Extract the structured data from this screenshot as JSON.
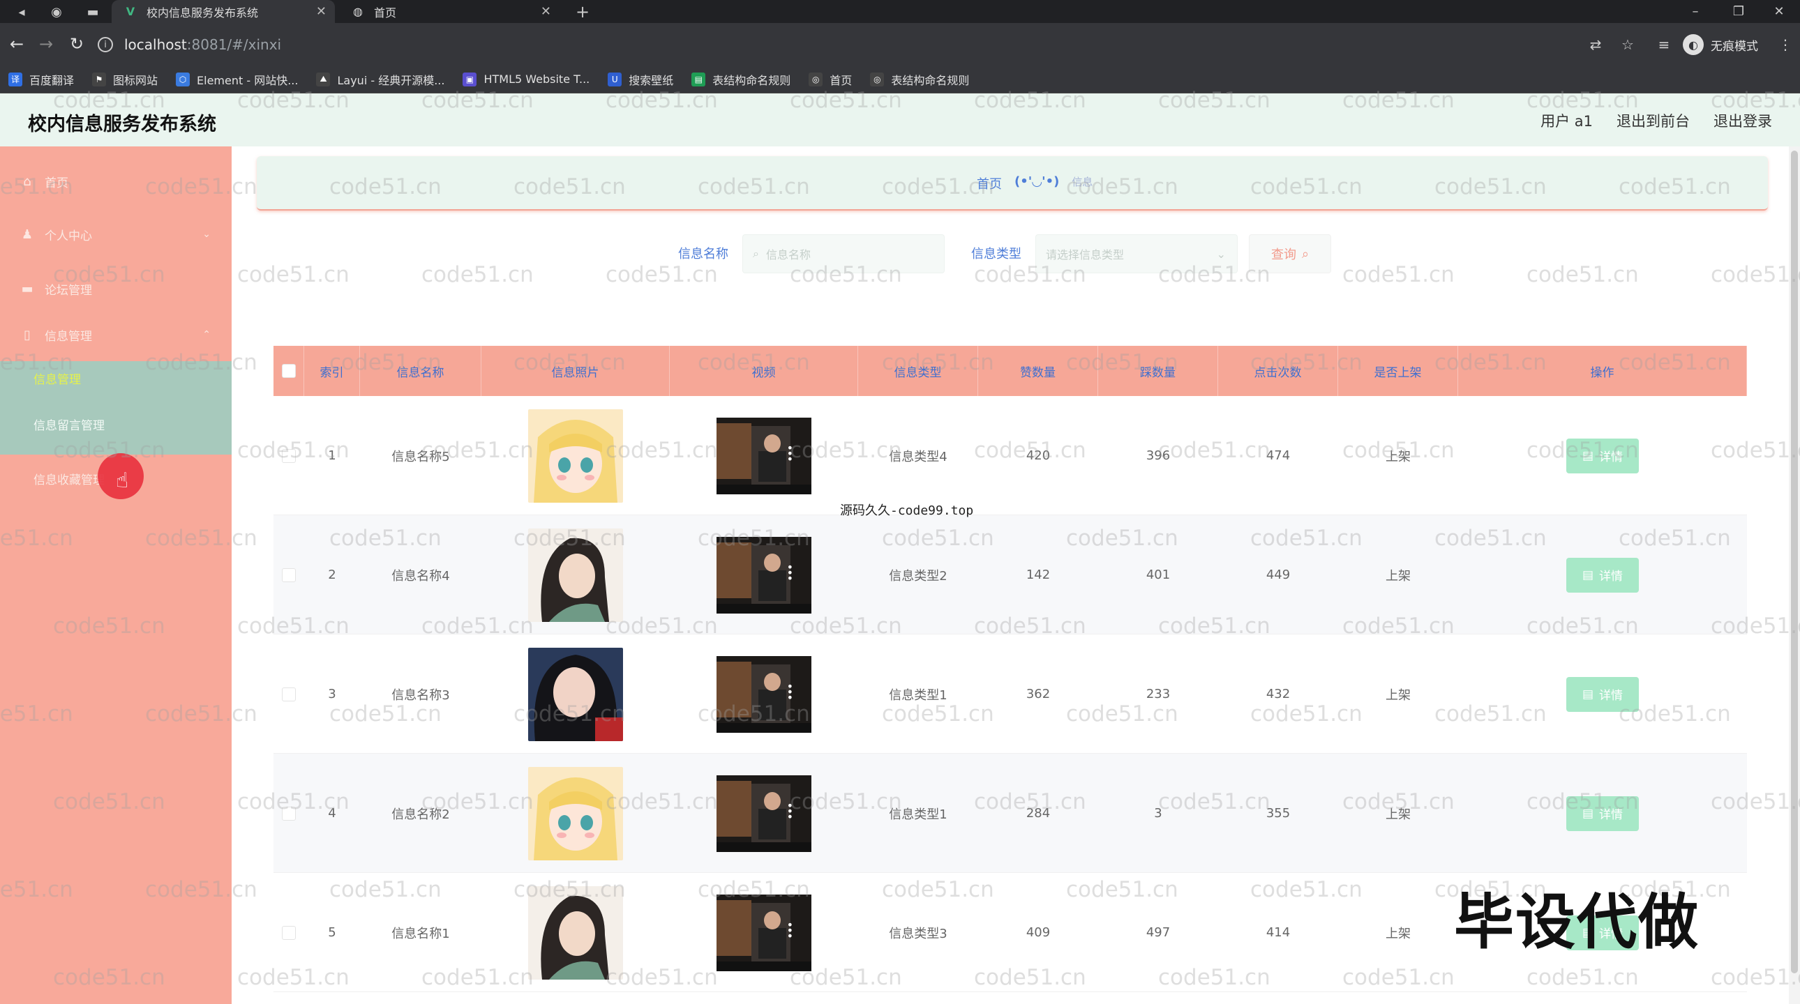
{
  "browser": {
    "tabs": [
      {
        "title": "校内信息服务发布系统",
        "favicon": "V",
        "active": true
      },
      {
        "title": "首页",
        "favicon": "globe",
        "active": false
      }
    ],
    "url_host": "localhost",
    "url_path": ":8081/#/xinxi",
    "incognito_label": "无痕模式",
    "bookmarks": [
      {
        "label": "百度翻译",
        "icon_color": "#2f6fe4",
        "icon": "译"
      },
      {
        "label": "图标网站",
        "icon_color": "#444444",
        "icon": "⚑"
      },
      {
        "label": "Element - 网站快...",
        "icon_color": "#3a7be0",
        "icon": "⬡"
      },
      {
        "label": "Layui - 经典开源模...",
        "icon_color": "#444444",
        "icon": "⛰"
      },
      {
        "label": "HTML5 Website T...",
        "icon_color": "#5a4fcf",
        "icon": "▣"
      },
      {
        "label": "搜索壁纸",
        "icon_color": "#2f5fd0",
        "icon": "U"
      },
      {
        "label": "表结构命名规则",
        "icon_color": "#1f9d55",
        "icon": "▤"
      },
      {
        "label": "首页",
        "icon_color": "#444444",
        "icon": "◎"
      },
      {
        "label": "表结构命名规则",
        "icon_color": "#444444",
        "icon": "◎"
      }
    ]
  },
  "header": {
    "title": "校内信息服务发布系统",
    "user": "用户 a1",
    "to_front": "退出到前台",
    "logout": "退出登录"
  },
  "sidebar": {
    "items": [
      {
        "label": "首页",
        "icon": "home-icon"
      },
      {
        "label": "个人中心",
        "icon": "user-icon"
      },
      {
        "label": "论坛管理",
        "icon": "forum-icon"
      },
      {
        "label": "信息管理",
        "icon": "info-icon"
      }
    ],
    "submenu": [
      {
        "label": "信息管理",
        "active": true
      },
      {
        "label": "信息留言管理",
        "active": false
      },
      {
        "label": "信息收藏管理",
        "active": false
      }
    ]
  },
  "breadcrumb": {
    "home": "首页",
    "face": "(•'◡'•)",
    "current": "信息"
  },
  "search": {
    "name_label": "信息名称",
    "name_placeholder": "信息名称",
    "type_label": "信息类型",
    "type_placeholder": "请选择信息类型",
    "query_button": "查询"
  },
  "table": {
    "headers": [
      "索引",
      "信息名称",
      "信息照片",
      "视频",
      "信息类型",
      "赞数量",
      "踩数量",
      "点击次数",
      "是否上架",
      "操作"
    ],
    "detail_label": "详情",
    "rows": [
      {
        "index": "1",
        "name": "信息名称5",
        "photo": "anime-blonde",
        "type": "信息类型4",
        "likes": "420",
        "dislikes": "396",
        "clicks": "474",
        "shelf": "上架"
      },
      {
        "index": "2",
        "name": "信息名称4",
        "photo": "girl-dark-hair",
        "type": "信息类型2",
        "likes": "142",
        "dislikes": "401",
        "clicks": "449",
        "shelf": "上架"
      },
      {
        "index": "3",
        "name": "信息名称3",
        "photo": "girl-portrait",
        "type": "信息类型1",
        "likes": "362",
        "dislikes": "233",
        "clicks": "432",
        "shelf": "上架"
      },
      {
        "index": "4",
        "name": "信息名称2",
        "photo": "anime-blonde",
        "type": "信息类型1",
        "likes": "284",
        "dislikes": "3",
        "clicks": "355",
        "shelf": "上架"
      },
      {
        "index": "5",
        "name": "信息名称1",
        "photo": "girl-dark-hair",
        "type": "信息类型3",
        "likes": "409",
        "dislikes": "497",
        "clicks": "414",
        "shelf": "上架"
      }
    ]
  },
  "overlays": {
    "watermark": "code51.cn",
    "center_mark": "源码久久-code99.top",
    "big_mark": "毕设代做"
  },
  "colors": {
    "sidebar": "#f8a99a",
    "header_bg": "#eaf5ef",
    "table_head": "#f6a797",
    "accent_blue": "#4f7ed8",
    "detail_btn": "#a7e8c7"
  }
}
